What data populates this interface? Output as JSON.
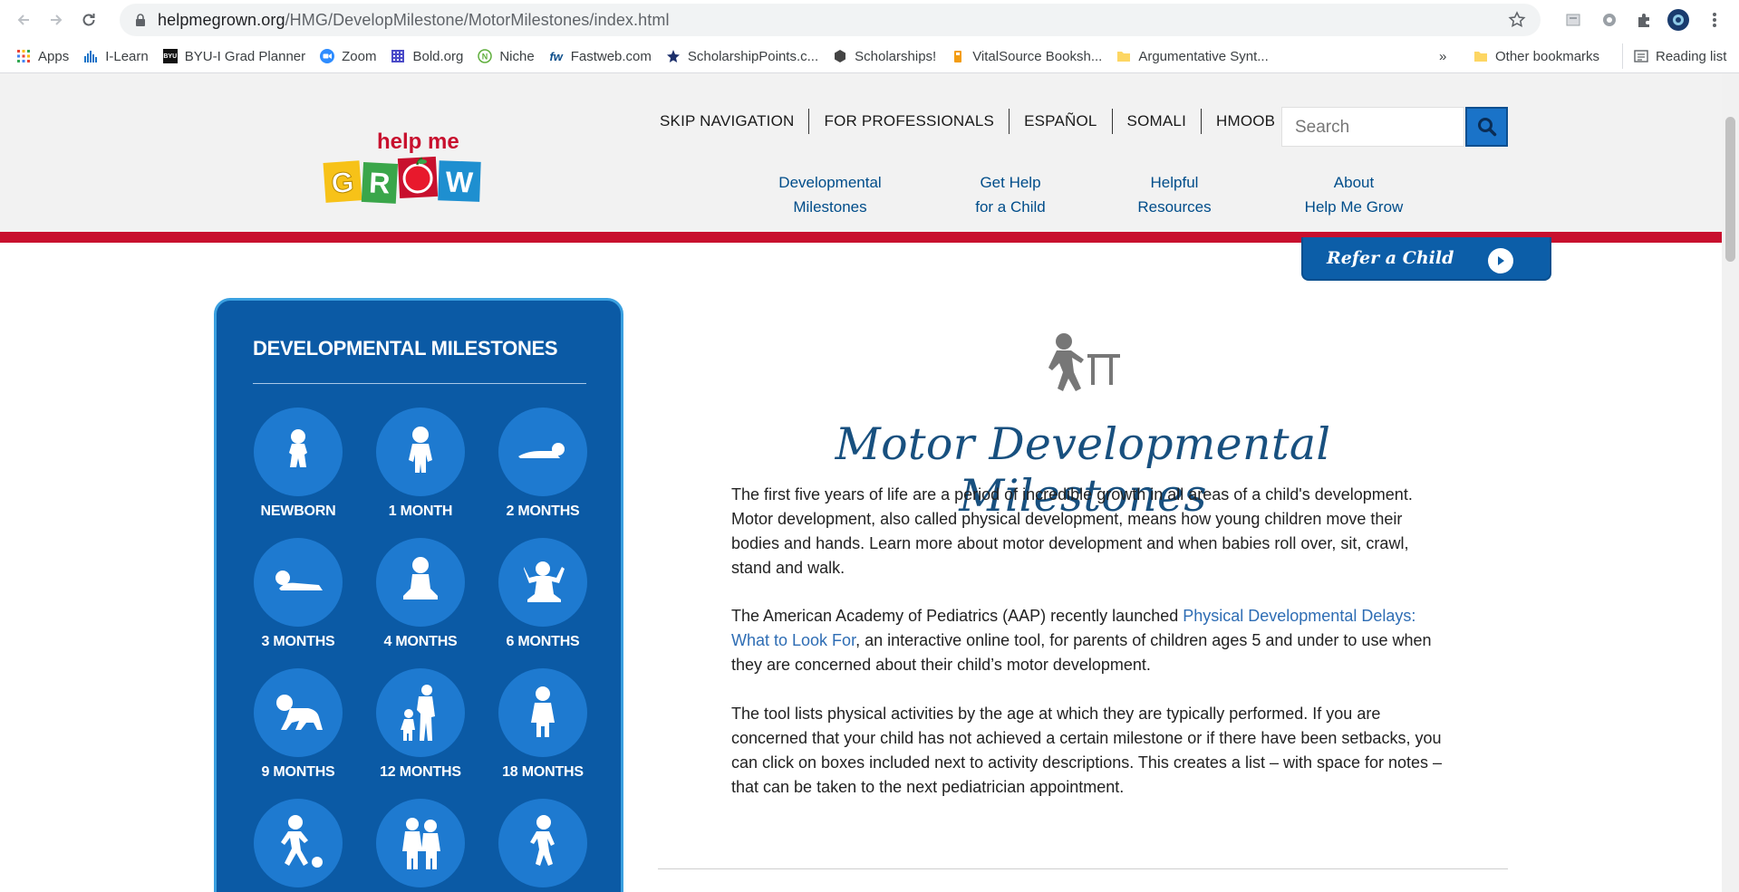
{
  "browser": {
    "url_host": "helpmegrown.org",
    "url_path": "/HMG/DevelopMilestone/MotorMilestones/index.html",
    "bookmarks": [
      {
        "label": "Apps",
        "icon": "apps-grid-icon"
      },
      {
        "label": "I-Learn",
        "icon": "ilearn-icon"
      },
      {
        "label": "BYU-I Grad Planner",
        "icon": "byu-icon"
      },
      {
        "label": "Zoom",
        "icon": "zoom-icon"
      },
      {
        "label": "Bold.org",
        "icon": "bold-icon"
      },
      {
        "label": "Niche",
        "icon": "niche-icon"
      },
      {
        "label": "Fastweb.com",
        "icon": "fastweb-icon"
      },
      {
        "label": "ScholarshipPoints.c...",
        "icon": "star-badge-icon"
      },
      {
        "label": "Scholarships!",
        "icon": "hexagon-icon"
      },
      {
        "label": "VitalSource Booksh...",
        "icon": "vitalsource-icon"
      },
      {
        "label": "Argumentative Synt...",
        "icon": "folder-icon"
      }
    ],
    "overflow_label": "»",
    "other_bookmarks": "Other bookmarks",
    "reading_list": "Reading list"
  },
  "header": {
    "logo_top": "help me",
    "logo_letters": [
      "G",
      "R",
      "W"
    ],
    "util_nav": [
      "SKIP NAVIGATION",
      "FOR PROFESSIONALS",
      "ESPAÑOL",
      "SOMALI",
      "HMOOB"
    ],
    "search_placeholder": "Search",
    "main_nav": [
      {
        "line1": "Developmental",
        "line2": "Milestones"
      },
      {
        "line1": "Get Help",
        "line2": "for a Child"
      },
      {
        "line1": "Helpful",
        "line2": "Resources"
      },
      {
        "line1": "About",
        "line2": "Help Me Grow"
      }
    ],
    "refer_label": "Refer a Child"
  },
  "sidebar": {
    "title": "DEVELOPMENTAL MILESTONES",
    "items": [
      "NEWBORN",
      "1 MONTH",
      "2 MONTHS",
      "3 MONTHS",
      "4 MONTHS",
      "6 MONTHS",
      "9 MONTHS",
      "12 MONTHS",
      "18 MONTHS"
    ]
  },
  "content": {
    "title": "Motor Developmental Milestones",
    "p1": "The first five years of life are a period of incredible growth in all areas of a child's development. Motor development, also called physical development, means how young children move their bodies and hands. Learn more about motor development and when babies roll over, sit, crawl, stand and walk.",
    "p2_before": "The American Academy of Pediatrics (AAP) recently launched ",
    "p2_link": "Physical Developmental Delays: What to Look For",
    "p2_after": ", an interactive online tool, for parents of children ages 5 and under to use when they are concerned about their child’s motor development.",
    "p3": "The tool lists physical activities by the age at which they are typically performed. If you are concerned that your child has not achieved a certain milestone or if there have been setbacks, you can click on boxes included next to activity descriptions. This creates a list – with space for notes – that can be taken to the next pediatrician appointment."
  },
  "colors": {
    "brand_blue": "#0b5aa5",
    "accent_red": "#c8102e",
    "title_blue": "#18507f",
    "link_blue": "#2e6db4"
  }
}
